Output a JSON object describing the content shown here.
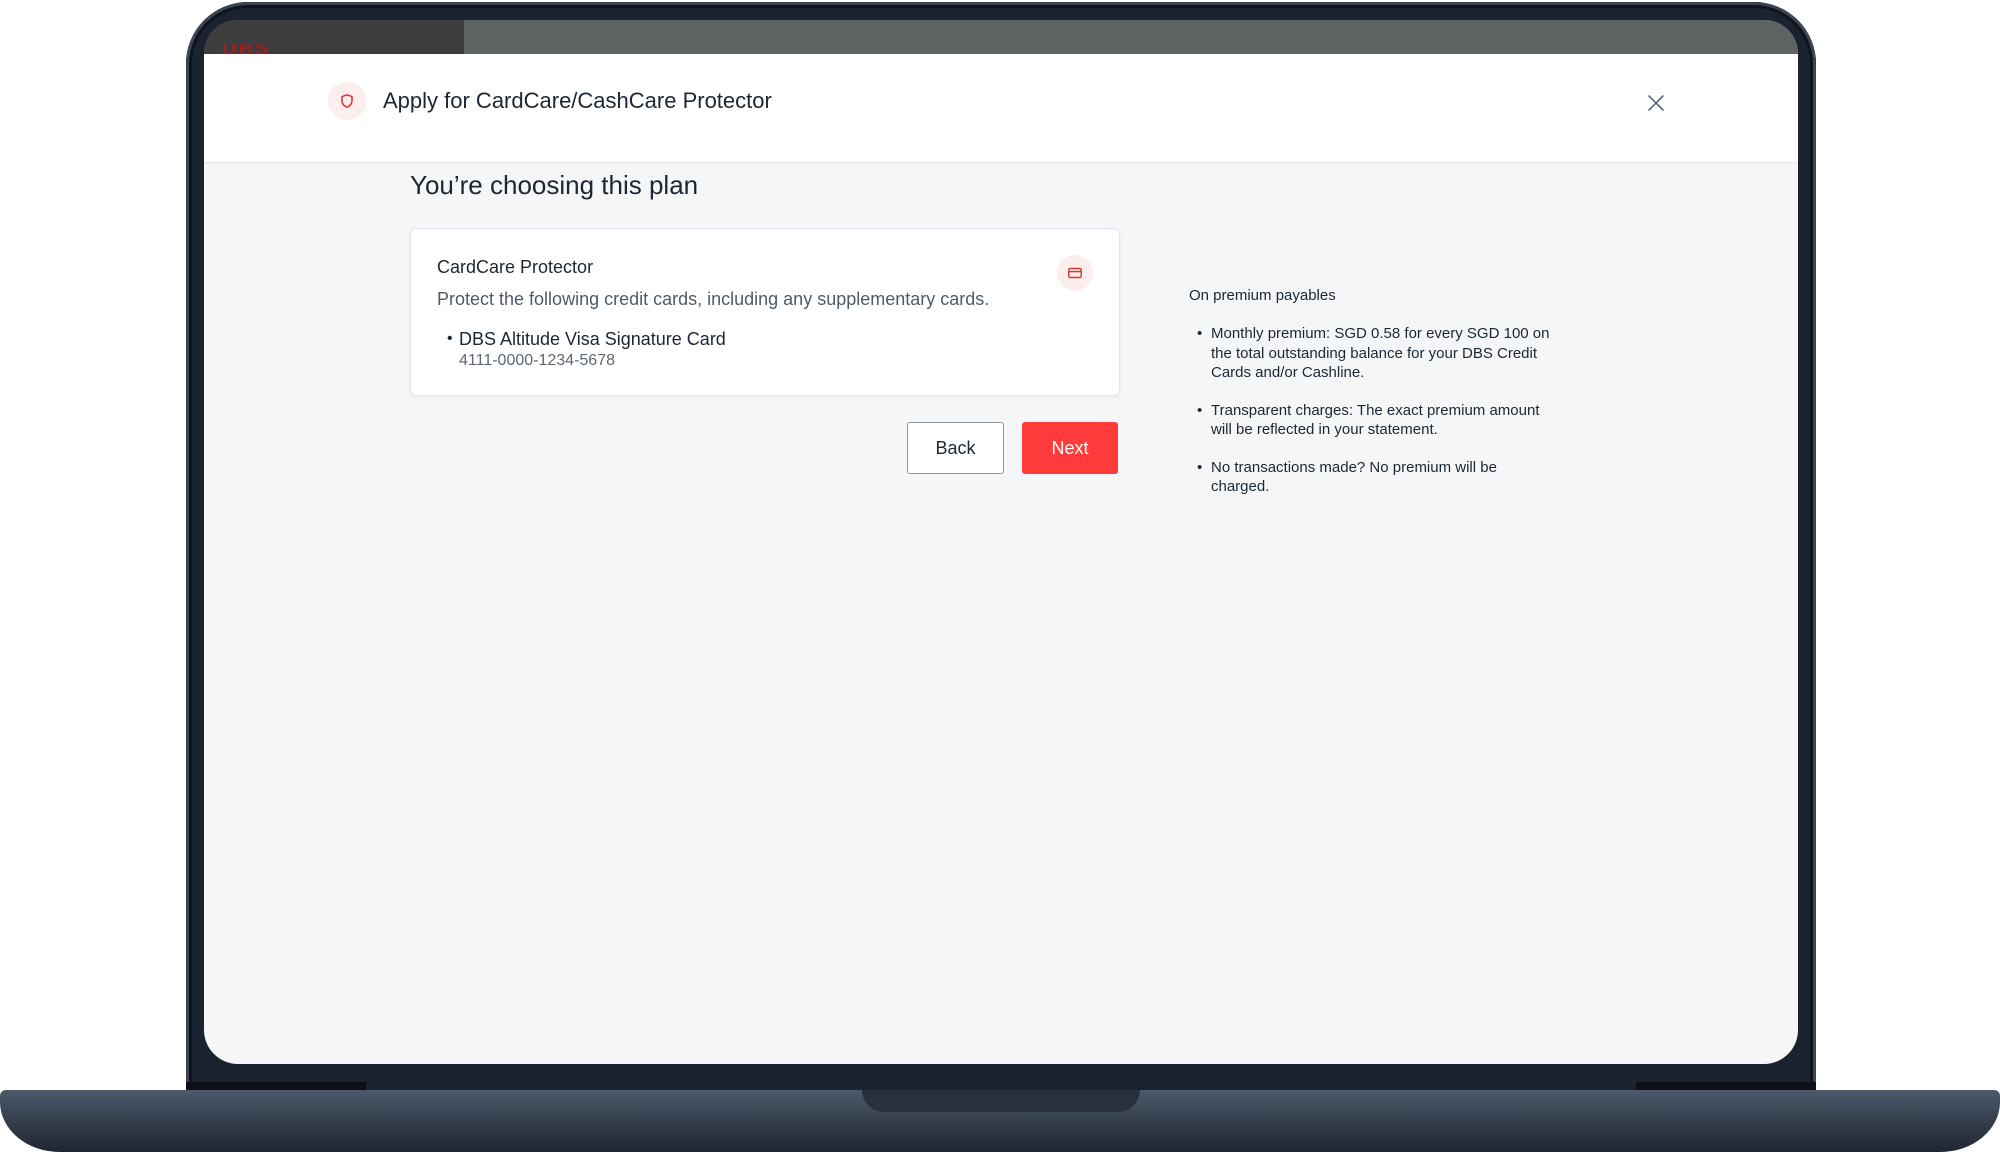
{
  "background": {
    "brand_partial": "DBS"
  },
  "header": {
    "title": "Apply for CardCare/CashCare Protector",
    "icon": "shield-icon",
    "close_icon": "close-icon"
  },
  "main": {
    "page_title": "You’re choosing this plan",
    "plan": {
      "name": "CardCare Protector",
      "description": "Protect the following credit cards, including any supplementary cards.",
      "icon": "credit-card-icon",
      "cards": [
        {
          "name": "DBS Altitude Visa Signature Card",
          "number": "4111-0000-1234-5678"
        }
      ]
    },
    "buttons": {
      "back_label": "Back",
      "next_label": "Next"
    }
  },
  "side_info": {
    "heading": "On premium payables",
    "items": [
      "Monthly premium: SGD 0.58 for every SGD 100 on the total outstanding balance for your DBS Credit Cards and/or Cashline.",
      "Transparent charges: The exact premium amount will be reflected in your statement.",
      "No transactions made? No premium will be charged."
    ]
  },
  "colors": {
    "accent": "#ff3b3b",
    "icon_bg": "#fdeeee",
    "text_primary": "#1c2733",
    "text_secondary": "#4f5b67",
    "page_bg": "#f5f6f8"
  }
}
